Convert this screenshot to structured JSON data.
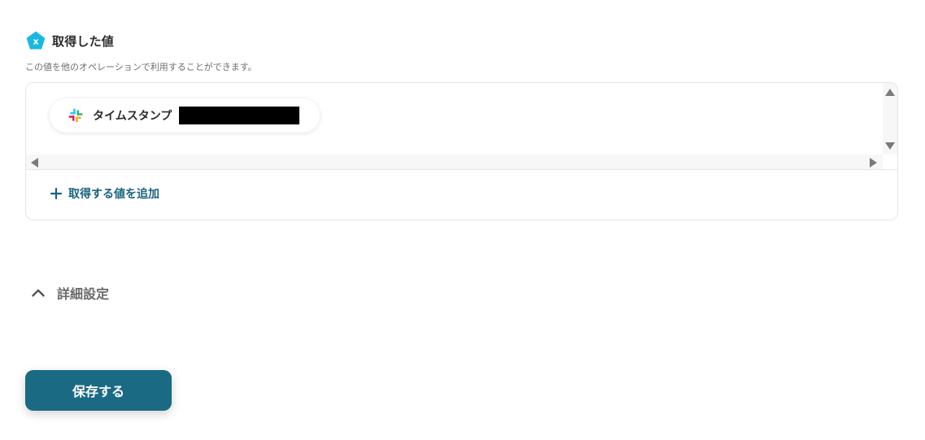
{
  "section": {
    "title": "取得した値",
    "description": "この値を他のオペレーションで利用することができます。",
    "icon": "variable-pentagon-icon",
    "icon_color": "#1ab8e0"
  },
  "value_box": {
    "chips": [
      {
        "icon": "slack-icon",
        "label": "タイムスタンプ",
        "value_redacted": true
      }
    ],
    "add_label": "取得する値を追加"
  },
  "advanced": {
    "label": "詳細設定",
    "icon": "chevron-up-icon"
  },
  "actions": {
    "save_label": "保存する",
    "save_color": "#1a6a84"
  },
  "colors": {
    "accent_text": "#19637f"
  }
}
